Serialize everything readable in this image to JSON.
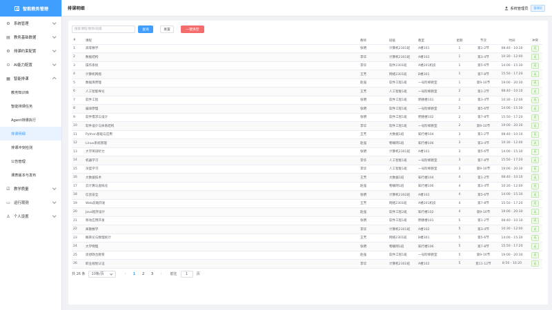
{
  "app": {
    "title": "智能教务管理"
  },
  "header": {
    "title": "排课明细",
    "user": "系统管理员",
    "role": "管理员"
  },
  "sidebar": {
    "items": [
      {
        "label": "系统管理",
        "icon": "gear-icon",
        "expanded": false
      },
      {
        "label": "教务基础数据",
        "icon": "database-icon",
        "expanded": false
      },
      {
        "label": "排课约束配置",
        "icon": "gear-icon",
        "expanded": false
      },
      {
        "label": "AI能力配置",
        "icon": "ai-icon",
        "expanded": false
      },
      {
        "label": "智能排课",
        "icon": "calendar-icon",
        "expanded": true
      },
      {
        "label": "教学质量",
        "icon": "checkbox-icon",
        "expanded": false
      },
      {
        "label": "运行观测",
        "icon": "monitor-icon",
        "expanded": false
      },
      {
        "label": "个人设置",
        "icon": "user-icon",
        "expanded": false
      }
    ],
    "subitems": [
      "教务知识库",
      "智能排课任务",
      "Agent排课执行",
      "排课明细",
      "排课冲突检测",
      "公告管理",
      "课表版本与发布"
    ],
    "active_subitem": "排课明细"
  },
  "toolbar": {
    "search_placeholder": "搜索课程/教师/班级",
    "search_label": "查询",
    "reset_label": "重置",
    "clear_label": "一键清空"
  },
  "table": {
    "columns": [
      "#",
      "课程",
      "教师",
      "班级",
      "教室",
      "星期",
      "节次",
      "时间",
      "冲突"
    ],
    "rows": [
      [
        "1",
        "高等数学",
        "张明",
        "计算机2301班",
        "A楼101",
        "1",
        "第1-2节",
        "08:40 - 10:10",
        "无"
      ],
      [
        "2",
        "数据结构",
        "李华",
        "计算机2301班",
        "A楼102",
        "1",
        "第3-4节",
        "10:30 - 12:00",
        "无"
      ],
      [
        "3",
        "操作系统",
        "李华",
        "软件2301班",
        "A楼201机房",
        "1",
        "第5-6节",
        "14:00 - 15:30",
        "无"
      ],
      [
        "4",
        "计算机网络",
        "王芳",
        "网络2301班",
        "B楼301",
        "1",
        "第7-8节",
        "15:50 - 17:20",
        "无"
      ],
      [
        "5",
        "数据库原理",
        "赵强",
        "软件工程1班",
        "一号阶梯教室",
        "1",
        "第9-10节",
        "19:00 - 20:30",
        "无"
      ],
      [
        "6",
        "人工智能导论",
        "王芳",
        "人工智能1班",
        "一号阶梯教室",
        "2",
        "第1-2节",
        "08:40 - 10:10",
        "无"
      ],
      [
        "7",
        "软件工程",
        "张明",
        "软件工程1班",
        "明德楼101",
        "2",
        "第3-4节",
        "10:30 - 12:00",
        "无"
      ],
      [
        "8",
        "编译原理",
        "张明",
        "软件工程1班",
        "一号阶梯教室",
        "2",
        "第5-6节",
        "14:00 - 15:30",
        "无"
      ],
      [
        "9",
        "软件需求与设计",
        "张明",
        "软件工程1班",
        "明德楼102",
        "2",
        "第7-8节",
        "15:50 - 17:20",
        "无"
      ],
      [
        "10",
        "软件设计与体系结构",
        "李华",
        "软件工程1班",
        "一号阶梯教室",
        "2",
        "第9-10节",
        "19:00 - 20:30",
        "无"
      ],
      [
        "11",
        "Python基础与应用",
        "王芳",
        "大数据1班",
        "知行楼104",
        "3",
        "第1-2节",
        "08:40 - 10:10",
        "无"
      ],
      [
        "12",
        "Linux系统管理",
        "赵强",
        "物联网1班",
        "知行楼106",
        "3",
        "第3-4节",
        "10:30 - 12:00",
        "无"
      ],
      [
        "13",
        "大学英语听力",
        "张明",
        "计算机2301班",
        "A楼101",
        "3",
        "第5-6节",
        "14:00 - 15:30",
        "无"
      ],
      [
        "14",
        "机器学习",
        "李华",
        "人工智能1班",
        "一号阶梯教室",
        "3",
        "第7-8节",
        "15:50 - 17:20",
        "无"
      ],
      [
        "15",
        "深度学习",
        "李华",
        "人工智能1班",
        "一号阶梯教室",
        "3",
        "第9-10节",
        "19:00 - 20:30",
        "无"
      ],
      [
        "16",
        "大数据技术",
        "王芳",
        "大数据1班",
        "知行楼104",
        "4",
        "第1-2节",
        "08:40 - 10:10",
        "无"
      ],
      [
        "17",
        "云计算与虚拟化",
        "赵强",
        "物联网1班",
        "知行楼106",
        "4",
        "第3-4节",
        "10:30 - 12:00",
        "无"
      ],
      [
        "18",
        "信息安全",
        "张明",
        "计算机2302班",
        "A楼102",
        "4",
        "第5-6节",
        "14:00 - 15:30",
        "无"
      ],
      [
        "19",
        "Web前端开发",
        "王芳",
        "网络2301班",
        "A楼201机房",
        "4",
        "第7-8节",
        "15:50 - 17:20",
        "无"
      ],
      [
        "20",
        "Java程序设计",
        "赵强",
        "软件工程2班",
        "知行楼102",
        "4",
        "第9-10节",
        "19:00 - 20:30",
        "无"
      ],
      [
        "21",
        "移动应用开发",
        "张明",
        "软件工程1班",
        "明德楼101",
        "5",
        "第1-2节",
        "08:40 - 10:10",
        "无"
      ],
      [
        "22",
        "离散数学",
        "李华",
        "计算机2301班",
        "A楼102",
        "5",
        "第3-4节",
        "10:30 - 12:00",
        "无"
      ],
      [
        "23",
        "概率论与数理统计",
        "王芳",
        "网络2301班",
        "B楼301",
        "5",
        "第5-6节",
        "14:00 - 15:30",
        "无"
      ],
      [
        "24",
        "大学物理",
        "张明",
        "物联网1班",
        "知行楼106",
        "5",
        "第7-8节",
        "15:50 - 17:20",
        "无"
      ],
      [
        "25",
        "思想政治教育",
        "赵强",
        "软件工程1班",
        "一号阶梯教室",
        "5",
        "第9-10节",
        "19:00 - 20:30",
        "无"
      ],
      [
        "26",
        "职业规划认证",
        "李华",
        "计算机2302班",
        "A楼102",
        "5",
        "第11-12节",
        "8:50 - 10:20",
        "无"
      ]
    ]
  },
  "pagination": {
    "total": "共 26 条",
    "page_size": "10条/页",
    "pages": [
      "1",
      "2",
      "3"
    ],
    "current": "1",
    "goto_label": "前往",
    "goto_value": "1",
    "page_unit": "页"
  }
}
